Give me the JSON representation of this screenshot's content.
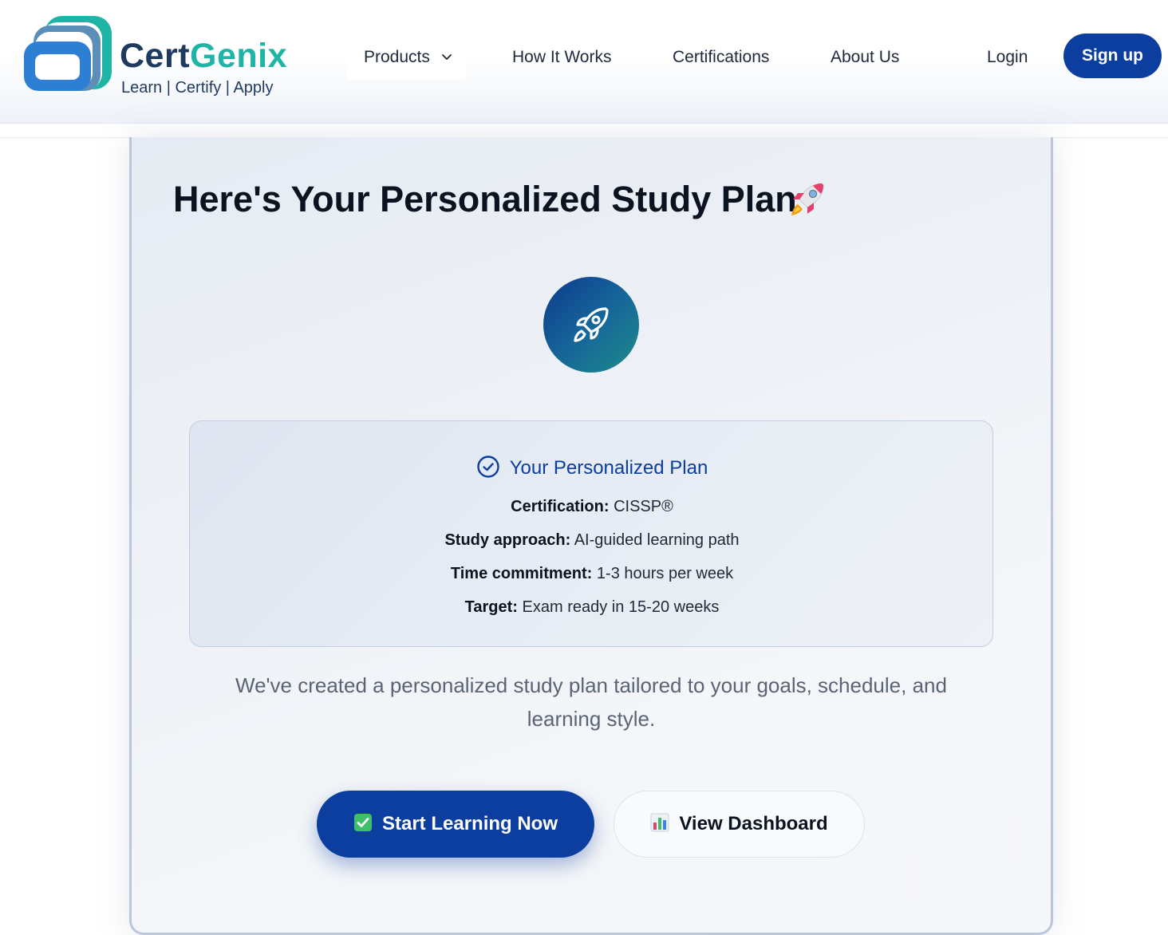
{
  "brand": {
    "name_part1": "Cert",
    "name_part2": "Genix",
    "tagline": "Learn | Certify | Apply",
    "colors": {
      "navy": "#1e3a5f",
      "teal": "#1fb5a6",
      "blue": "#2d7fd3"
    }
  },
  "nav": {
    "items": [
      {
        "label": "Products",
        "has_dropdown": true,
        "icon": "chevron-down-icon"
      },
      {
        "label": "How It Works"
      },
      {
        "label": "Certifications"
      },
      {
        "label": "About Us"
      }
    ],
    "login_label": "Login",
    "signup_label": "Sign up"
  },
  "page": {
    "title": "Here's Your Personalized Study Plan",
    "title_icon": "rocket-emoji-icon",
    "hero_icon": "rocket-icon"
  },
  "plan": {
    "heading": "Your Personalized Plan",
    "heading_icon": "check-circle-icon",
    "rows": [
      {
        "label": "Certification:",
        "value": "CISSP®"
      },
      {
        "label": "Study approach:",
        "value": "AI-guided learning path"
      },
      {
        "label": "Time commitment:",
        "value": "1-3 hours per week"
      },
      {
        "label": "Target:",
        "value": "Exam ready in 15-20 weeks"
      }
    ]
  },
  "subtitle": "We've created a personalized study plan tailored to your goals, schedule, and learning style.",
  "actions": {
    "start_label": "Start Learning Now",
    "start_icon": "check-box-icon",
    "dashboard_label": "View Dashboard",
    "dashboard_icon": "bar-chart-icon"
  },
  "colors": {
    "primary": "#0b3e9e",
    "card_border": "#b9c6dd",
    "heading_text": "#0b1220"
  }
}
